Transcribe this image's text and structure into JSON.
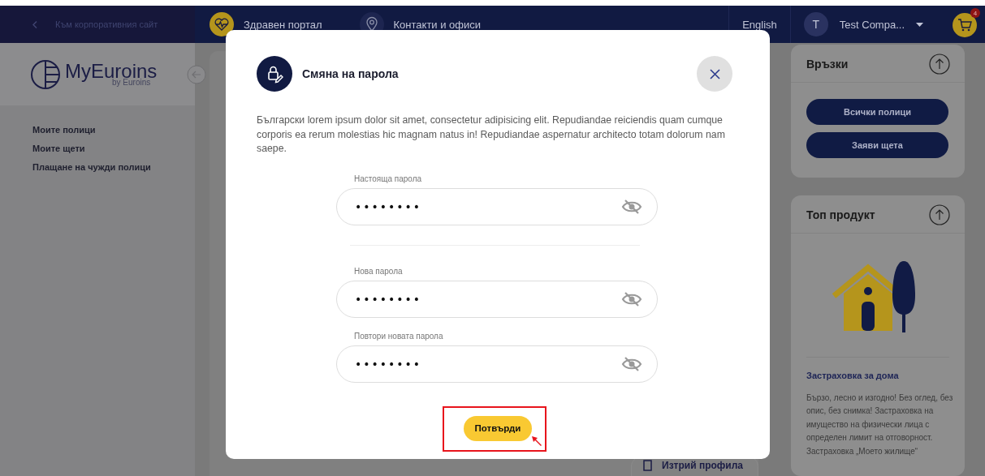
{
  "header": {
    "back_link": "Към корпоративния сайт",
    "nav": [
      {
        "label": "Здравен портал"
      },
      {
        "label": "Контакти и офиси"
      }
    ],
    "language": "English",
    "user": {
      "avatar": "T",
      "name": "Test Compa..."
    },
    "cart": {
      "count": "4"
    }
  },
  "sidebar": {
    "logo": {
      "name_light": "My",
      "name_bold": "Euroins",
      "tagline": "by Euroins"
    },
    "items": [
      "Моите полици",
      "Моите щети",
      "Плащане на чужди полици"
    ]
  },
  "delete_profile": "Изтрий профила",
  "links_card": {
    "title": "Връзки",
    "buttons": [
      "Всички полици",
      "Заяви щета"
    ]
  },
  "product_card": {
    "title": "Топ продукт",
    "name": "Застраховка за дома",
    "description": "Бързо, лесно и изгодно! Без оглед, без опис, без снимка! Застраховка на имущество на физически лица с определен лимит на отговорност. Застраховка „Моето жилище“"
  },
  "modal": {
    "title": "Смяна на парола",
    "text": "Български lorem ipsum dolor sit amet, consectetur adipisicing elit. Repudiandae reiciendis quam cumque corporis ea rerum molestias hic magnam natus in! Repudiandae aspernatur architecto totam dolorum nam saepe.",
    "fields": [
      {
        "label": "Настояща парола",
        "value": "••••••••"
      },
      {
        "label": "Нова парола",
        "value": "••••••••"
      },
      {
        "label": "Повтори новата парола",
        "value": "••••••••"
      }
    ],
    "confirm": {
      "label": "Потвърди",
      "highlighted": true
    }
  }
}
